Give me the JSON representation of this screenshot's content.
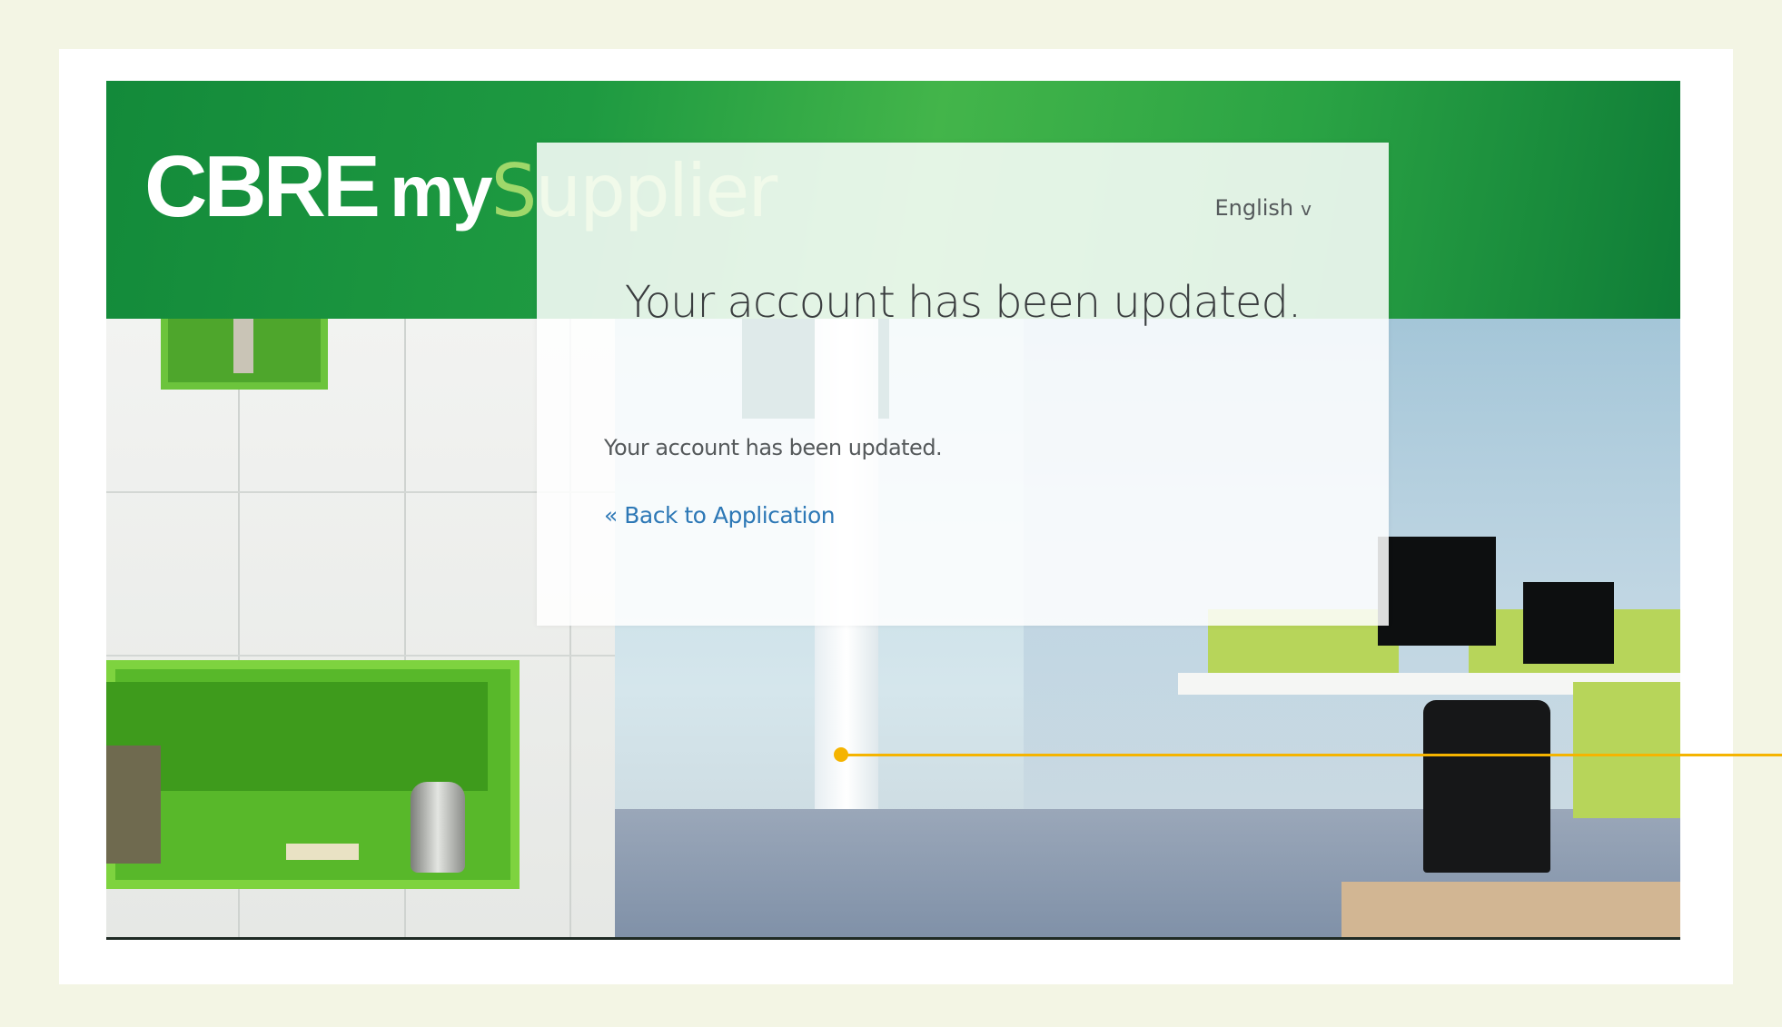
{
  "header": {
    "logo": {
      "brand": "CBRE",
      "my": "my",
      "product": "Supplier"
    }
  },
  "card": {
    "language": "English",
    "language_chevron": "v",
    "title": "Your account has been updated.",
    "message": "Your account has been updated.",
    "back_link": "« Back to Application"
  },
  "colors": {
    "banner_green": "#1e9a41",
    "logo_accent": "#9fd86a",
    "link_blue": "#2d78b6",
    "callout": "#f5b400",
    "page_background": "#f3f5e4"
  }
}
